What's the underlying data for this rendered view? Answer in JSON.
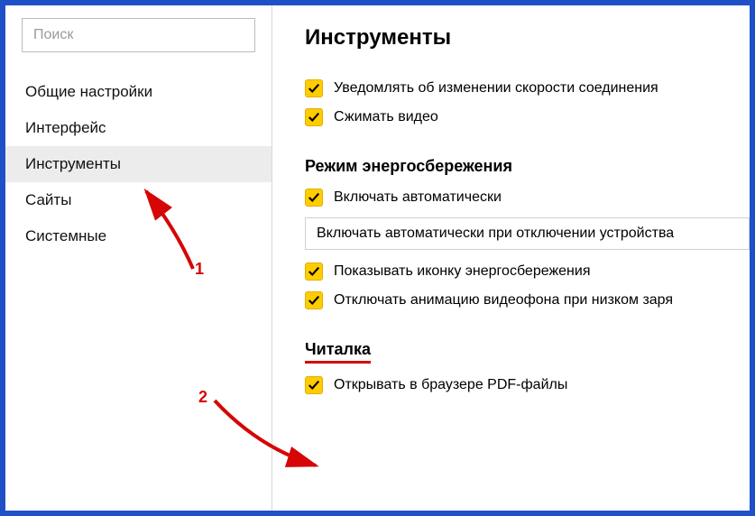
{
  "search": {
    "placeholder": "Поиск"
  },
  "sidebar": {
    "items": [
      {
        "label": "Общие настройки",
        "active": false
      },
      {
        "label": "Интерфейс",
        "active": false
      },
      {
        "label": "Инструменты",
        "active": true
      },
      {
        "label": "Сайты",
        "active": false
      },
      {
        "label": "Системные",
        "active": false
      }
    ]
  },
  "main": {
    "heading": "Инструменты",
    "top_opts": [
      {
        "label": "Уведомлять об изменении скорости соединения",
        "checked": true
      },
      {
        "label": "Сжимать видео",
        "checked": true
      }
    ],
    "power": {
      "title": "Режим энергосбережения",
      "auto": {
        "label": "Включать автоматически",
        "checked": true
      },
      "select": "Включать автоматически при отключении устройства",
      "show_icon": {
        "label": "Показывать иконку энергосбережения",
        "checked": true
      },
      "disable_anim": {
        "label": "Отключать анимацию видеофона при низком заря",
        "checked": true
      }
    },
    "reader": {
      "title": "Читалка",
      "pdf": {
        "label": "Открывать в браузере PDF-файлы",
        "checked": true
      }
    }
  },
  "annotations": {
    "n1": "1",
    "n2": "2"
  }
}
